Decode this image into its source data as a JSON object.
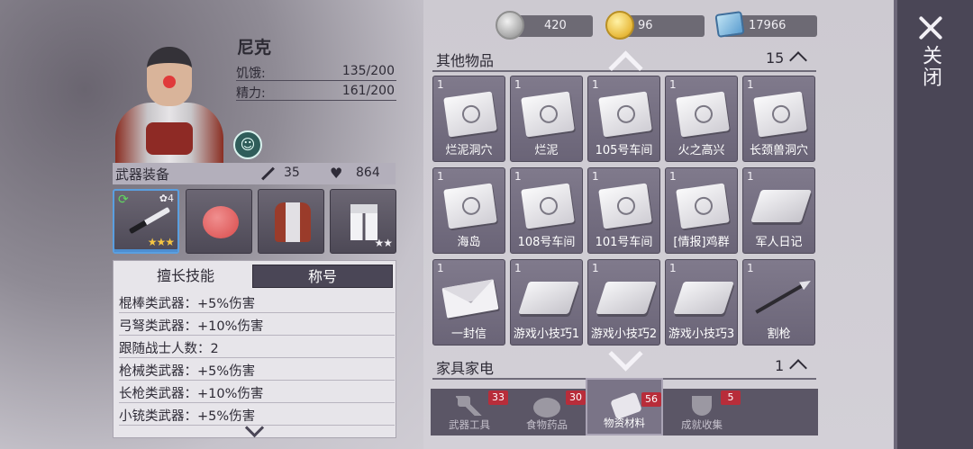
{
  "resources": [
    {
      "icon": "silver-coin-icon",
      "value": "420"
    },
    {
      "icon": "gold-coin-icon",
      "value": "96"
    },
    {
      "icon": "ticket-icon",
      "value": "17966"
    }
  ],
  "character": {
    "name": "尼克",
    "stats": [
      {
        "label": "饥饿:",
        "value": "135/200"
      },
      {
        "label": "精力:",
        "value": "161/200"
      }
    ]
  },
  "equipment": {
    "title": "武器装备",
    "attack": "35",
    "health": "864",
    "slots": [
      {
        "stars": "★★★",
        "level": "4"
      },
      {},
      {},
      {
        "stars": "★★"
      }
    ]
  },
  "skills": {
    "tabs": [
      "擅长技能",
      "称号"
    ],
    "lines": [
      "棍棒类武器：+5%伤害",
      "弓弩类武器：+10%伤害",
      "跟随战士人数：2",
      "枪械类武器：+5%伤害",
      "长枪类武器：+10%伤害",
      "小铳类武器：+5%伤害"
    ]
  },
  "inventory": {
    "section1": {
      "title": "其他物品",
      "count": "15"
    },
    "section2": {
      "title": "家具家电",
      "count": "1"
    },
    "items": [
      {
        "qty": "1",
        "label": "烂泥洞穴",
        "icon": "map-paper-icon"
      },
      {
        "qty": "1",
        "label": "烂泥",
        "icon": "map-paper-icon"
      },
      {
        "qty": "1",
        "label": "105号车间",
        "icon": "map-paper-icon"
      },
      {
        "qty": "1",
        "label": "火之高兴",
        "icon": "map-paper-icon"
      },
      {
        "qty": "1",
        "label": "长颈兽洞穴",
        "icon": "map-paper-icon"
      },
      {
        "qty": "1",
        "label": "海岛",
        "icon": "map-paper-icon"
      },
      {
        "qty": "1",
        "label": "108号车间",
        "icon": "map-paper-icon"
      },
      {
        "qty": "1",
        "label": "101号车间",
        "icon": "map-paper-icon"
      },
      {
        "qty": "1",
        "label": "[情报]鸡群",
        "icon": "map-paper-icon"
      },
      {
        "qty": "1",
        "label": "军人日记",
        "icon": "book-icon"
      },
      {
        "qty": "1",
        "label": "一封信",
        "icon": "letter-icon"
      },
      {
        "qty": "1",
        "label": "游戏小技巧1",
        "icon": "book-icon"
      },
      {
        "qty": "1",
        "label": "游戏小技巧2",
        "icon": "book-icon"
      },
      {
        "qty": "1",
        "label": "游戏小技巧3",
        "icon": "book-icon"
      },
      {
        "qty": "1",
        "label": "割枪",
        "icon": "cutting-torch-icon"
      }
    ]
  },
  "bottom_tabs": [
    {
      "label": "武器工具",
      "count": "33",
      "icon": "axe-icon"
    },
    {
      "label": "食物药品",
      "count": "30",
      "icon": "food-icon"
    },
    {
      "label": "物资材料",
      "count": "56",
      "icon": "wood-log-icon",
      "selected": true
    },
    {
      "label": "成就收集",
      "count": "5",
      "icon": "trophy-icon"
    }
  ],
  "close_label": "关闭"
}
